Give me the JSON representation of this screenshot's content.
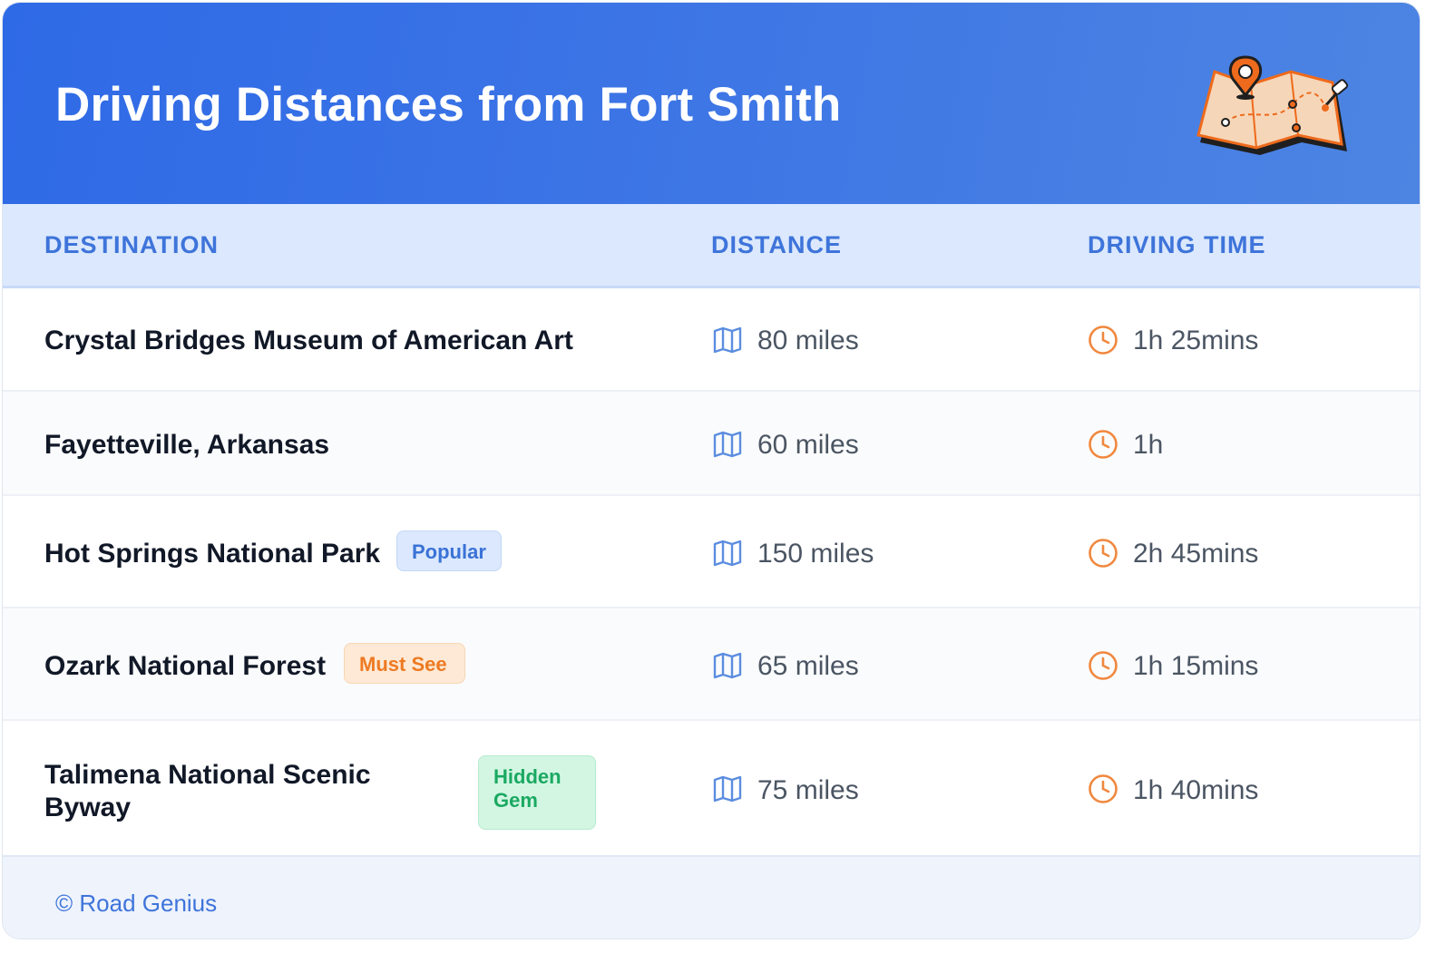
{
  "header": {
    "title": "Driving Distances from Fort Smith"
  },
  "icons": {
    "header_icon": "map-with-pin-icon",
    "distance_icon": "map-icon",
    "time_icon": "clock-icon"
  },
  "colors": {
    "header_gradient_start": "#2f6ae6",
    "header_gradient_end": "#4d85e3",
    "accent_blue": "#3e74da",
    "accent_orange": "#ee7a22",
    "accent_green": "#1aa961"
  },
  "table": {
    "columns": [
      "DESTINATION",
      "DISTANCE",
      "DRIVING TIME"
    ],
    "rows": [
      {
        "destination": "Crystal Bridges Museum of American Art",
        "badge": "",
        "distance": "80 miles",
        "time": "1h 25mins"
      },
      {
        "destination": "Fayetteville, Arkansas",
        "badge": "",
        "distance": "60 miles",
        "time": "1h"
      },
      {
        "destination": "Hot Springs National Park",
        "badge": "Popular",
        "distance": "150 miles",
        "time": "2h 45mins"
      },
      {
        "destination": "Ozark National Forest",
        "badge": "Must See",
        "distance": "65 miles",
        "time": "1h 15mins"
      },
      {
        "destination": "Talimena National Scenic Byway",
        "badge": "Hidden Gem",
        "distance": "75 miles",
        "time": "1h 40mins"
      }
    ]
  },
  "footer": {
    "credit": "© Road Genius"
  }
}
